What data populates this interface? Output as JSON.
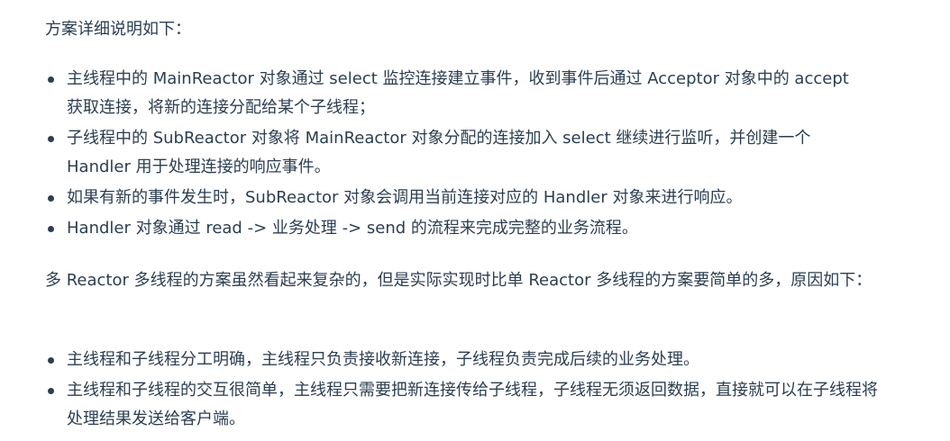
{
  "intro": "方案详细说明如下：",
  "details": [
    "主线程中的 MainReactor 对象通过 select 监控连接建立事件，收到事件后通过 Acceptor 对象中的 accept 获取连接，将新的连接分配给某个子线程；",
    "子线程中的 SubReactor 对象将 MainReactor 对象分配的连接加入 select 继续进行监听，并创建一个 Handler 用于处理连接的响应事件。",
    "如果有新的事件发生时，SubReactor 对象会调用当前连接对应的 Handler 对象来进行响应。",
    "Handler 对象通过 read -> 业务处理 -> send 的流程来完成完整的业务流程。"
  ],
  "summary": "多 Reactor 多线程的方案虽然看起来复杂的，但是实际实现时比单 Reactor 多线程的方案要简单的多，原因如下：",
  "reasons": [
    "主线程和子线程分工明确，主线程只负责接收新连接，子线程负责完成后续的业务处理。",
    "主线程和子线程的交互很简单，主线程只需要把新连接传给子线程，子线程无须返回数据，直接就可以在子线程将处理结果发送给客户端。"
  ]
}
